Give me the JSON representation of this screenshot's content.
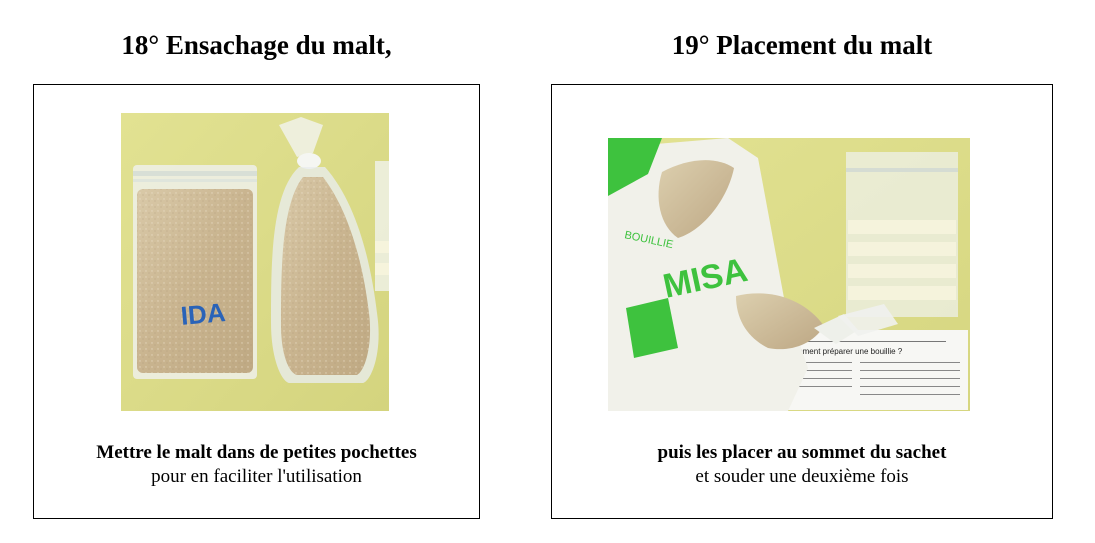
{
  "left_step": {
    "title": "18° Ensachage du malt,",
    "caption_bold": "Mettre le malt dans de petites pochettes",
    "caption_normal": "pour en faciliter l'utilisation",
    "photo_bag_brand": "IDA"
  },
  "right_step": {
    "title": "19° Placement du malt",
    "caption_bold": "puis les placer au sommet du sachet",
    "caption_normal": "et souder une deuxième fois",
    "photo_bag_brand": "MISA",
    "photo_bag_text": "BOUILLIE",
    "photo_leaflet_heading": "Comment préparer une bouillie ?"
  },
  "colors": {
    "photo_background": "#dede8a",
    "malt_powder": "#cdbb99",
    "brand_blue": "#2a63b8",
    "brand_green": "#3ec23e"
  }
}
